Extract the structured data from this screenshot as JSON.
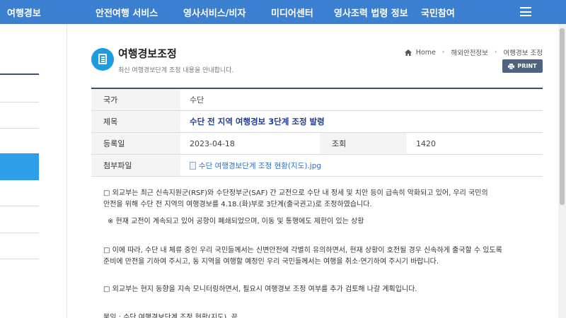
{
  "topnav": {
    "brand": "여행경보",
    "items": [
      "안전여행 서비스",
      "영사서비스/비자",
      "미디어센터",
      "영사조력 법령 정보",
      "국민참여"
    ]
  },
  "header": {
    "title": "여행경보조정",
    "subtitle": "최신 여행경보단계 조정 내용을 안내합니다.",
    "breadcrumb": [
      "Home",
      "해외안전정보",
      "여행경보 조정"
    ],
    "print_label": "PRINT"
  },
  "info": {
    "country_label": "국가",
    "country_value": "수단",
    "title_label": "제목",
    "title_value": "수단 전 지역 여행경보 3단계 조정 발령",
    "date_label": "등록일",
    "date_value": "2023-04-18",
    "views_label": "조회",
    "views_value": "1420",
    "attach_label": "첨부파일",
    "attach_value": "수단 여행경보단계 조정 현황(지도).jpg"
  },
  "body": {
    "p1_line1": "□ 외교부는 최근 신속지원군(RSF)와 수단정부군(SAF) 간 교전으로 수단 내 정세 및 치안 등이 급속히 악화되고 있어, 우리 국민의",
    "p1_line2": "안전을 위해 수단 전 지역의 여행경보를 4.18.(화)부로 3단계(출국권고)로 조정하였습니다.",
    "note": "※ 현재 교전이 계속되고 있어 공항이 폐쇄되었으며, 이동 및 통행에도 제한이 있는 상황",
    "p2_line1": "□ 이에 따라, 수단 내 체류 중인 우리 국민들께서는 신변안전에 각별히 유의하면서, 현재 상황이 호전될 경우 신속하게 출국할 수 있도록",
    "p2_line2": "준비에 만전을 기하여 주시고, 동 지역을 여행할 예정인 우리 국민들께서는 여행을 취소·연기하여 주시기 바랍니다.",
    "p3": "□ 외교부는 현지 동향을 지속 모니터링하면서, 필요시 여행경보 조정 여부를 추가 검토해 나갈 계획입니다.",
    "footer_partial": "붙임 : 수단 여행경보단계 조정 현황(지도). 끝."
  }
}
